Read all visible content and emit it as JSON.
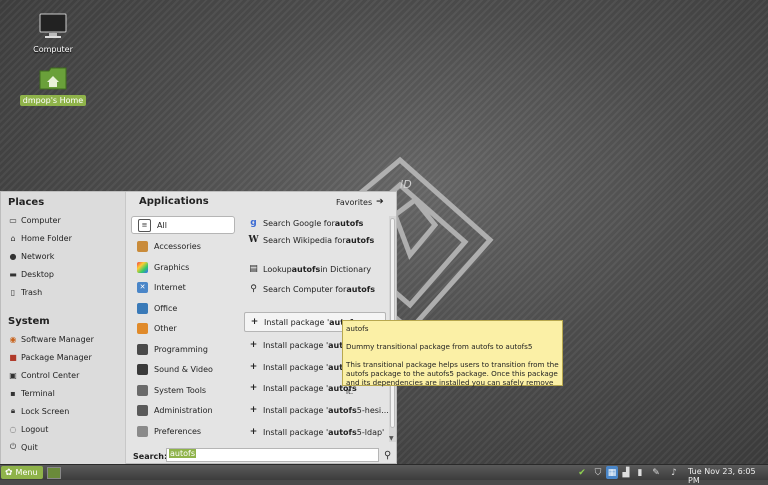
{
  "desktop": {
    "icons": [
      {
        "label": "Computer",
        "icon": "monitor-icon"
      },
      {
        "label": "dmpop's Home",
        "icon": "home-folder-icon"
      }
    ]
  },
  "menu": {
    "places": {
      "title": "Places",
      "items": [
        {
          "label": "Computer",
          "icon": "computer-icon"
        },
        {
          "label": "Home Folder",
          "icon": "home-icon"
        },
        {
          "label": "Network",
          "icon": "network-icon"
        },
        {
          "label": "Desktop",
          "icon": "desktop-icon"
        },
        {
          "label": "Trash",
          "icon": "trash-icon"
        }
      ]
    },
    "system": {
      "title": "System",
      "items": [
        {
          "label": "Software Manager",
          "icon": "software-manager-icon"
        },
        {
          "label": "Package Manager",
          "icon": "package-manager-icon"
        },
        {
          "label": "Control Center",
          "icon": "control-center-icon"
        },
        {
          "label": "Terminal",
          "icon": "terminal-icon"
        },
        {
          "label": "Lock Screen",
          "icon": "lock-icon"
        },
        {
          "label": "Logout",
          "icon": "logout-icon"
        },
        {
          "label": "Quit",
          "icon": "quit-icon"
        }
      ]
    },
    "applications_title": "Applications",
    "favorites_label": "Favorites",
    "categories": [
      {
        "label": "All",
        "icon": "all-icon",
        "color": "#ffffff"
      },
      {
        "label": "Accessories",
        "icon": "accessories-icon",
        "color": "#c98b3a"
      },
      {
        "label": "Graphics",
        "icon": "graphics-icon",
        "color": "#d4486a"
      },
      {
        "label": "Internet",
        "icon": "internet-icon",
        "color": "#4a86c8"
      },
      {
        "label": "Office",
        "icon": "office-icon",
        "color": "#3a7ab8"
      },
      {
        "label": "Other",
        "icon": "other-icon",
        "color": "#e08a2a"
      },
      {
        "label": "Programming",
        "icon": "programming-icon",
        "color": "#4a4a4a"
      },
      {
        "label": "Sound & Video",
        "icon": "sound-video-icon",
        "color": "#3a3a3a"
      },
      {
        "label": "System Tools",
        "icon": "system-tools-icon",
        "color": "#6a6a6a"
      },
      {
        "label": "Administration",
        "icon": "administration-icon",
        "color": "#5a5a5a"
      },
      {
        "label": "Preferences",
        "icon": "preferences-icon",
        "color": "#8a8a8a"
      }
    ],
    "results": [
      {
        "prefix": "Search Google for ",
        "term": "autofs",
        "suffix": "",
        "icon": "google-icon"
      },
      {
        "prefix": "Search Wikipedia for ",
        "term": "autofs",
        "suffix": "",
        "icon": "wikipedia-icon"
      },
      {
        "prefix": "Lookup ",
        "term": "autofs",
        "suffix": " in Dictionary",
        "icon": "dictionary-icon"
      },
      {
        "prefix": "Search Computer for ",
        "term": "autofs",
        "suffix": "",
        "icon": "search-icon"
      },
      {
        "prefix": "Install package '",
        "term": "autof",
        "suffix": "",
        "icon": "plus-icon"
      },
      {
        "prefix": "Install package '",
        "term": "auto",
        "suffix": "",
        "icon": "plus-icon"
      },
      {
        "prefix": "Install package '",
        "term": "auto",
        "suffix": "",
        "icon": "plus-icon"
      },
      {
        "prefix": "Install package '",
        "term": "autofs",
        "suffix": "",
        "icon": "plus-icon"
      },
      {
        "prefix": "Install package '",
        "term": "autofs",
        "suffix": "5-hesi...",
        "icon": "plus-icon"
      },
      {
        "prefix": "Install package '",
        "term": "autofs",
        "suffix": "5-ldap'",
        "icon": "plus-icon"
      }
    ],
    "search": {
      "label": "Search:",
      "value": "autofs"
    },
    "tooltip": {
      "title": "autofs",
      "summary": "Dummy transitional package from autofs to autofs5",
      "description": "This transitional package helps users to transition from the autofs package to the autofs5 package. Once this package and its dependencies are installed you can safely remove it."
    }
  },
  "panel": {
    "menu_label": "Menu",
    "clock": "Tue Nov 23,  6:05 PM",
    "tray_icons": [
      "update-check-icon",
      "shield-icon",
      "keyboard-icon",
      "network-signal-icon",
      "battery-icon",
      "pin-icon",
      "volume-icon"
    ]
  },
  "colors": {
    "accent": "#8fb34a",
    "tooltip_bg": "#fbf0a6"
  }
}
